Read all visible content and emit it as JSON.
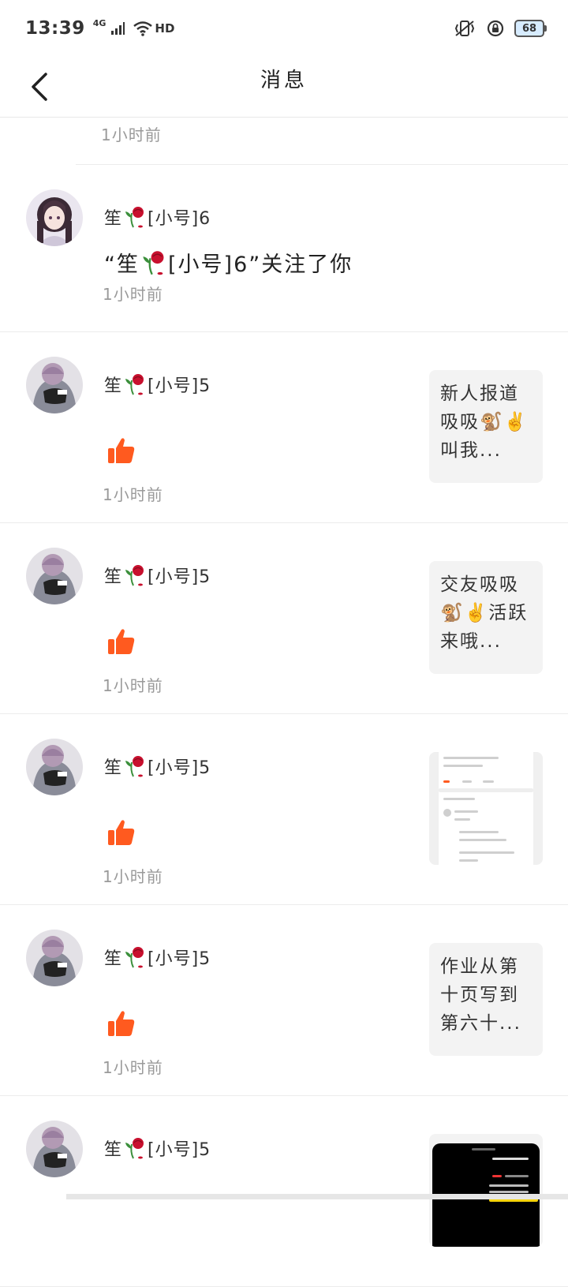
{
  "status": {
    "time": "13:39",
    "network": "4G",
    "hd": "HD",
    "battery": "68"
  },
  "header": {
    "title": "消息"
  },
  "partial": {
    "time": "1小时前"
  },
  "items": [
    {
      "type": "follow",
      "username": "笙",
      "suffix": "[小号]6",
      "follow_prefix": "“笙",
      "follow_suffix": "[小号]6”关注了你",
      "time": "1小时前"
    },
    {
      "type": "like",
      "username": "笙",
      "suffix": "[小号]5",
      "time": "1小时前",
      "thumb_text": "新人报道吸吸🐒✌️叫我..."
    },
    {
      "type": "like",
      "username": "笙",
      "suffix": "[小号]5",
      "time": "1小时前",
      "thumb_text": "交友吸吸🐒✌️活跃来哦..."
    },
    {
      "type": "like",
      "username": "笙",
      "suffix": "[小号]5",
      "time": "1小时前",
      "thumb_kind": "screenshot"
    },
    {
      "type": "like",
      "username": "笙",
      "suffix": "[小号]5",
      "time": "1小时前",
      "thumb_text": "作业从第十页写到第六十..."
    },
    {
      "type": "like",
      "username": "笙",
      "suffix": "[小号]5",
      "time": "",
      "thumb_kind": "dark-screenshot"
    }
  ],
  "colors": {
    "like": "#ff5a1f",
    "rose": "#c8102e",
    "stem": "#3b8f3b"
  }
}
